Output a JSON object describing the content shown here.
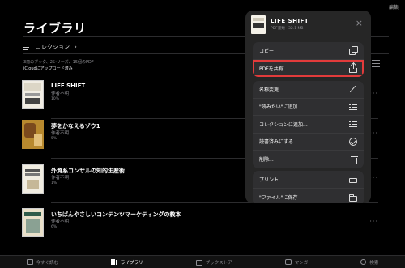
{
  "header": {
    "edit_label": "編集",
    "title": "ライブラリ"
  },
  "collections": {
    "label": "コレクション",
    "chevron": "›"
  },
  "summary": "3冊のブック、2シリーズ、15個のPDF",
  "icloud_status": "iCloudにアップロード済み",
  "books": [
    {
      "title": "LIFE SHIFT",
      "author": "作者不明",
      "progress": "10%",
      "more": "···"
    },
    {
      "title": "夢をかなえるゾウ1",
      "author": "作者不明",
      "progress": "5%",
      "more": "···"
    },
    {
      "title": "外資系コンサルの知的生産術",
      "author": "作者不明",
      "progress": "1%",
      "more": "···"
    },
    {
      "title": "いちばんやさしいコンテンツマーケティングの教本",
      "author": "作者不明",
      "progress": "6%",
      "more": "···"
    }
  ],
  "popover": {
    "book_title": "LIFE SHIFT",
    "book_meta": "PDF書類 · 32.1 MB",
    "close": "×",
    "group1": [
      {
        "label": "コピー",
        "icon": "copy-icon"
      },
      {
        "label": "PDFを共有",
        "icon": "share-icon"
      }
    ],
    "group2": [
      {
        "label": "名称変更...",
        "icon": "pencil-icon"
      },
      {
        "label": "\"読みたい\"に追加",
        "icon": "list-add-icon"
      },
      {
        "label": "コレクションに追加...",
        "icon": "list-add-icon"
      },
      {
        "label": "読書済みにする",
        "icon": "checkmark-circle-icon"
      },
      {
        "label": "削除...",
        "icon": "trash-icon"
      }
    ],
    "group3": [
      {
        "label": "プリント",
        "icon": "printer-icon"
      },
      {
        "label": "\"ファイル\"に保存",
        "icon": "folder-icon"
      }
    ],
    "highlight_color": "#e23b3b"
  },
  "tabbar": [
    {
      "label": "今すぐ読む",
      "icon": "book-open-icon",
      "active": false
    },
    {
      "label": "ライブラリ",
      "icon": "library-icon",
      "active": true
    },
    {
      "label": "ブックストア",
      "icon": "bag-icon",
      "active": false
    },
    {
      "label": "マンガ",
      "icon": "manga-icon",
      "active": false
    },
    {
      "label": "検索",
      "icon": "search-icon",
      "active": false
    }
  ]
}
